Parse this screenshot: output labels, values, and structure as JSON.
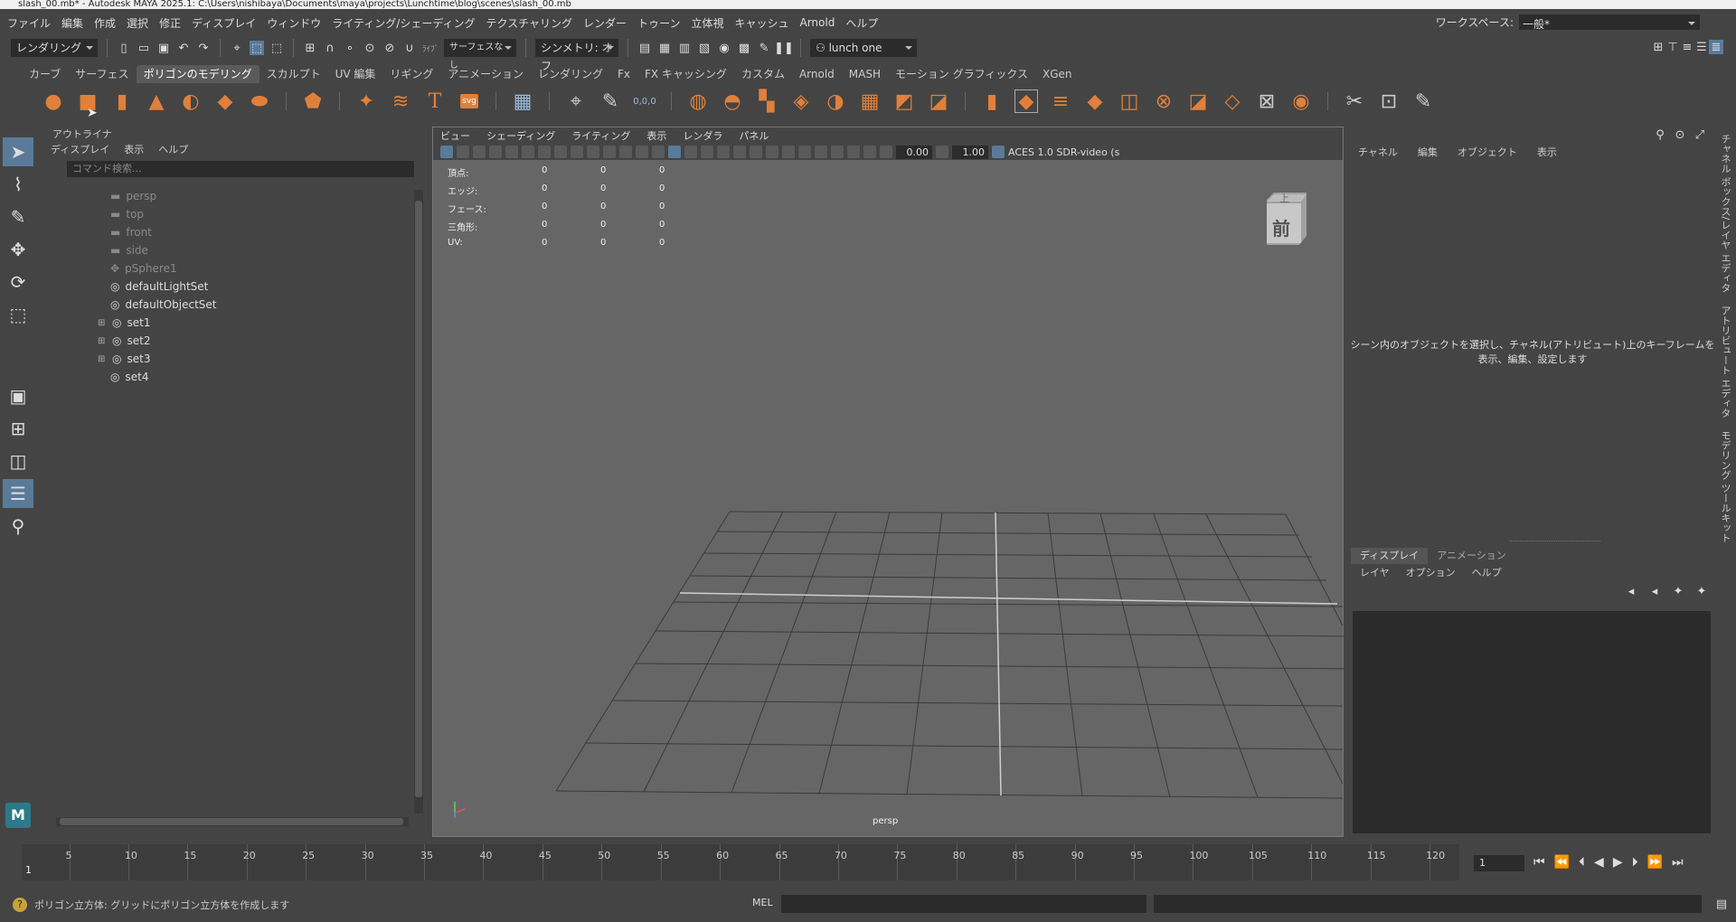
{
  "window": {
    "title": "slash_00.mb* - Autodesk MAYA 2025.1: C:\\Users\\nishibaya\\Documents\\maya\\projects\\Lunchtime\\blog\\scenes\\slash_00.mb"
  },
  "menubar": {
    "items": [
      "ファイル",
      "編集",
      "作成",
      "選択",
      "修正",
      "ディスプレイ",
      "ウィンドウ",
      "ライティング/シェーディング",
      "テクスチャリング",
      "レンダー",
      "トゥーン",
      "立体視",
      "キャッシュ",
      "Arnold",
      "ヘルプ"
    ],
    "workspace_label": "ワークスペース:",
    "workspace_value": "一般*"
  },
  "statusline": {
    "menuset": "レンダリング",
    "live_label": "ﾗｲﾌﾞ",
    "live_value": "サーフェスなし",
    "symmetry": "シンメトリ: オフ",
    "user": "lunch one"
  },
  "shelf": {
    "tabs": [
      "カーブ",
      "サーフェス",
      "ポリゴンのモデリング",
      "スカルプト",
      "UV 編集",
      "リギング",
      "アニメーション",
      "レンダリング",
      "Fx",
      "FX キャッシング",
      "カスタム",
      "Arnold",
      "MASH",
      "モーション グラフィックス",
      "XGen"
    ],
    "active_tab": "ポリゴンのモデリング",
    "svg_label": "svg",
    "text_label": "T",
    "origin_label": "0,0,0"
  },
  "outliner": {
    "title": "アウトライナ",
    "menu": [
      "ディスプレイ",
      "表示",
      "ヘルプ"
    ],
    "search_placeholder": "コマンド検索...",
    "nodes": [
      {
        "label": "persp",
        "icon": "camera-icon",
        "dim": true
      },
      {
        "label": "top",
        "icon": "camera-icon",
        "dim": true
      },
      {
        "label": "front",
        "icon": "camera-icon",
        "dim": true
      },
      {
        "label": "side",
        "icon": "camera-icon",
        "dim": true
      },
      {
        "label": "pSphere1",
        "icon": "transform-icon",
        "dim": true
      },
      {
        "label": "defaultLightSet",
        "icon": "set-icon",
        "dim": false
      },
      {
        "label": "defaultObjectSet",
        "icon": "set-icon",
        "dim": false
      },
      {
        "label": "set1",
        "icon": "set-icon",
        "dim": false,
        "expandable": true
      },
      {
        "label": "set2",
        "icon": "set-icon",
        "dim": false,
        "expandable": true
      },
      {
        "label": "set3",
        "icon": "set-icon",
        "dim": false,
        "expandable": true
      },
      {
        "label": "set4",
        "icon": "set-icon",
        "dim": false
      }
    ]
  },
  "viewport": {
    "menu": [
      "ビュー",
      "シェーディング",
      "ライティング",
      "表示",
      "レンダラ",
      "パネル"
    ],
    "exposure": "0.00",
    "gamma": "1.00",
    "colorspace": "ACES 1.0 SDR-video (s",
    "hud": [
      {
        "label": "頂点:",
        "values": [
          "0",
          "0",
          "0"
        ]
      },
      {
        "label": "エッジ:",
        "values": [
          "0",
          "0",
          "0"
        ]
      },
      {
        "label": "フェース:",
        "values": [
          "0",
          "0",
          "0"
        ]
      },
      {
        "label": "三角形:",
        "values": [
          "0",
          "0",
          "0"
        ]
      },
      {
        "label": "UV:",
        "values": [
          "0",
          "0",
          "0"
        ]
      }
    ],
    "viewcube_top": "上",
    "viewcube_front": "前",
    "camera_label": "persp"
  },
  "channelbox": {
    "menu": [
      "チャネル",
      "編集",
      "オブジェクト",
      "表示"
    ],
    "message_line1": "シーン内のオブジェクトを選択し、チャネル(アトリビュート)上のキーフレームを",
    "message_line2": "表示、編集、設定します"
  },
  "layers": {
    "tabs": [
      "ディスプレイ",
      "アニメーション"
    ],
    "active_tab": "ディスプレイ",
    "menu": [
      "レイヤ",
      "オプション",
      "ヘルプ"
    ]
  },
  "side_tabs": [
    "チャネル ボックス/レイヤ エディタ",
    "アトリビュート エディタ",
    "モデリング ツールキット"
  ],
  "timeline": {
    "ticks": [
      "5",
      "10",
      "15",
      "20",
      "25",
      "30",
      "35",
      "40",
      "45",
      "50",
      "55",
      "60",
      "65",
      "70",
      "75",
      "80",
      "85",
      "90",
      "95",
      "100",
      "105",
      "110",
      "115",
      "120"
    ],
    "start_frame": "1",
    "current_frame": "1"
  },
  "helpline": {
    "text": "ポリゴン立方体: グリッドにポリゴン立方体を作成します",
    "mel_label": "MEL"
  }
}
